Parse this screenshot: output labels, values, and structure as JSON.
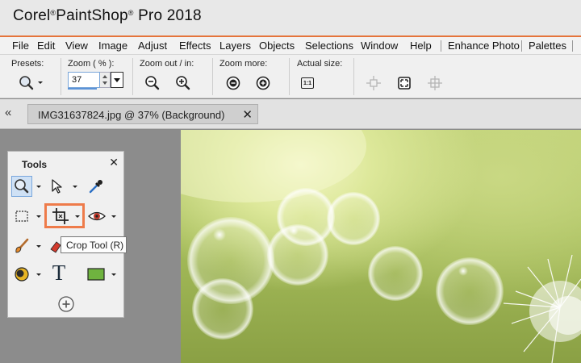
{
  "app": {
    "title_part1": "Corel",
    "title_part2": "PaintShop",
    "title_part3": "Pro 2018",
    "accent_color": "#e5743a"
  },
  "menu": {
    "items": [
      "File",
      "Edit",
      "View",
      "Image",
      "Adjust",
      "Effects",
      "Layers",
      "Objects",
      "Selections",
      "Window",
      "Help",
      "Enhance Photo",
      "Palettes"
    ]
  },
  "toolbar": {
    "presets_label": "Presets:",
    "zoom_label": "Zoom ( % ):",
    "zoom_value": "37",
    "zoom_out_in_label": "Zoom out / in:",
    "zoom_more_label": "Zoom more:",
    "actual_size_label": "Actual size:",
    "actual_size_glyph": "1:1"
  },
  "document": {
    "tab_label": "IMG31637824.jpg @  37% (Background)",
    "close_glyph": "✕",
    "collapse_glyph": "«"
  },
  "tools_panel": {
    "title": "Tools",
    "close_glyph": "✕",
    "text_tool_glyph": "T",
    "tooltip": "Crop Tool (R)",
    "highlight_color": "#ee7b4a"
  }
}
